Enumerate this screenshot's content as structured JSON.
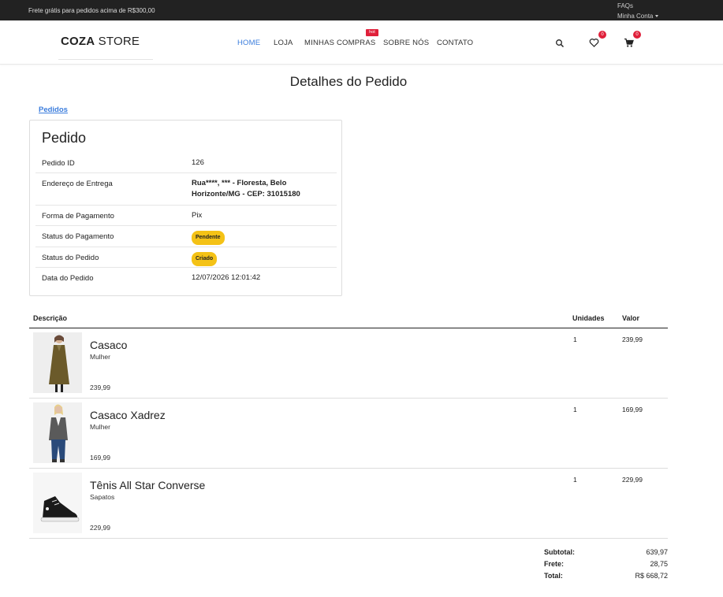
{
  "topbar": {
    "free_shipping": "Frete grátis para pedidos acima de R$300,00",
    "faqs": "FAQs",
    "account": "Minha Conta"
  },
  "header": {
    "logo_bold": "COZA",
    "logo_light": " STORE",
    "nav": [
      {
        "label": "HOME",
        "active": true
      },
      {
        "label": "LOJA"
      },
      {
        "label": "MINHAS COMPRAS",
        "badge": "hot"
      },
      {
        "label": "SOBRE NÓS"
      },
      {
        "label": "CONTATO"
      }
    ],
    "wishlist_count": "0",
    "cart_count": "0"
  },
  "page": {
    "title": "Detalhes do Pedido",
    "breadcrumb": "Pedidos"
  },
  "order": {
    "card_title": "Pedido",
    "rows": [
      {
        "label": "Pedido ID",
        "value": "126"
      },
      {
        "label": "Endereço de Entrega",
        "value": "Rua****, *** - Floresta, Belo Horizonte/MG - CEP: 31015180"
      },
      {
        "label": "Forma de Pagamento",
        "value": "Pix"
      },
      {
        "label": "Status do Pagamento",
        "value": "Pendente"
      },
      {
        "label": "Status do Pedido",
        "value": "Criado"
      },
      {
        "label": "Data do Pedido",
        "value": "12/07/2026 12:01:42"
      }
    ]
  },
  "items_table": {
    "headers": {
      "desc": "Descrição",
      "units": "Unidades",
      "value": "Valor"
    },
    "items": [
      {
        "name": "Casaco",
        "category": "Mulher",
        "price": "239,99",
        "units": "1",
        "value": "239,99"
      },
      {
        "name": "Casaco Xadrez",
        "category": "Mulher",
        "price": "169,99",
        "units": "1",
        "value": "169,99"
      },
      {
        "name": "Tênis All Star Converse",
        "category": "Sapatos",
        "price": "229,99",
        "units": "1",
        "value": "229,99"
      }
    ]
  },
  "totals": {
    "subtotal_label": "Subtotal:",
    "subtotal": "639,97",
    "shipping_label": "Frete:",
    "shipping": "28,75",
    "total_label": "Total:",
    "total": "R$ 668,72"
  },
  "colors": {
    "accent": "#3b7ddd",
    "badge": "#e0203a",
    "status": "#f4c216",
    "topbar": "#222222"
  }
}
